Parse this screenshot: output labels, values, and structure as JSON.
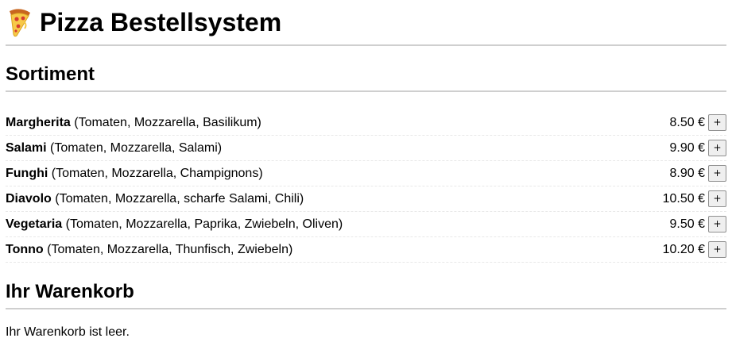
{
  "header": {
    "title": "Pizza Bestellsystem",
    "icon": "pizza-icon"
  },
  "sortiment": {
    "heading": "Sortiment",
    "products": [
      {
        "name": "Margherita",
        "ingredients": "(Tomaten, Mozzarella, Basilikum)",
        "price": "8.50 €",
        "add_label": "+"
      },
      {
        "name": "Salami",
        "ingredients": "(Tomaten, Mozzarella, Salami)",
        "price": "9.90 €",
        "add_label": "+"
      },
      {
        "name": "Funghi",
        "ingredients": "(Tomaten, Mozzarella, Champignons)",
        "price": "8.90 €",
        "add_label": "+"
      },
      {
        "name": "Diavolo",
        "ingredients": "(Tomaten, Mozzarella, scharfe Salami, Chili)",
        "price": "10.50 €",
        "add_label": "+"
      },
      {
        "name": "Vegetaria",
        "ingredients": "(Tomaten, Mozzarella, Paprika, Zwiebeln, Oliven)",
        "price": "9.50 €",
        "add_label": "+"
      },
      {
        "name": "Tonno",
        "ingredients": "(Tomaten, Mozzarella, Thunfisch, Zwiebeln)",
        "price": "10.20 €",
        "add_label": "+"
      }
    ]
  },
  "cart": {
    "heading": "Ihr Warenkorb",
    "empty_text": "Ihr Warenkorb ist leer."
  },
  "colors": {
    "divider": "#cfcfcf",
    "pizza_crust": "#e8902c",
    "pizza_cheese": "#f7c948",
    "pizza_topping": "#d63b2f"
  }
}
